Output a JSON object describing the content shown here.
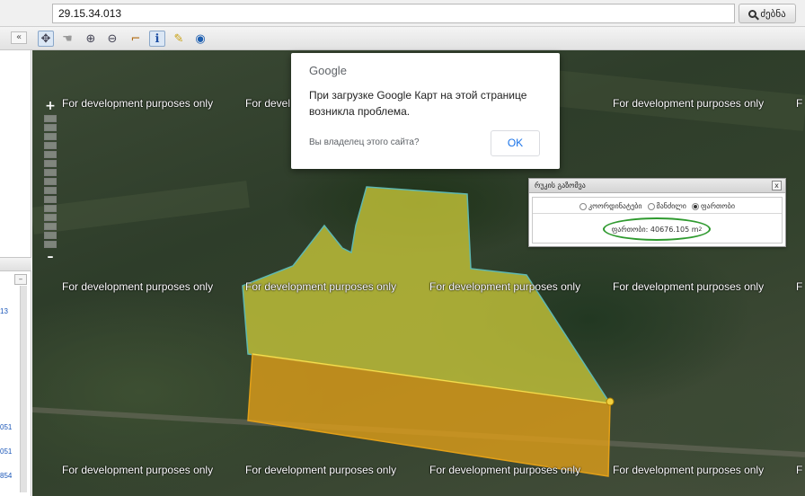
{
  "search": {
    "value": "29.15.34.013",
    "button_label": "ძებნა"
  },
  "toolbar": {
    "collapse_label": "«",
    "tools": [
      "pan-icon",
      "hand-icon",
      "zoom-in-icon",
      "zoom-out-icon",
      "ruler-icon",
      "info-icon",
      "highlight-icon",
      "globe-icon"
    ]
  },
  "sidebar": {
    "collapse_minus": "–",
    "items": [
      "13",
      "",
      "",
      "051",
      "051",
      "854"
    ]
  },
  "map": {
    "zoom_plus": "+",
    "zoom_minus": "–",
    "watermark": "For development purposes only",
    "watermark_cut_left": "For devel",
    "watermark_cut_right": "F"
  },
  "google_dialog": {
    "logo": "Google",
    "message": "При загрузке Google Карт на этой странице возникла проблема.",
    "question": "Вы владелец этого сайта?",
    "ok_label": "OK"
  },
  "measure_panel": {
    "title": "რუკის გაზომვა",
    "close": "x",
    "options": [
      {
        "label": "კოორდინატები",
        "selected": false
      },
      {
        "label": "მანძილი",
        "selected": false
      },
      {
        "label": "ფართობი",
        "selected": true
      }
    ],
    "result_label": "ფართობი:",
    "result_value": "40676.105",
    "result_unit": "m",
    "result_unit_power": "2"
  },
  "colors": {
    "parcel_yellow": "#c9c83a",
    "parcel_orange": "#e3a018",
    "outline_teal": "#5fb8b0",
    "highlight_green": "#2f9a2f"
  }
}
